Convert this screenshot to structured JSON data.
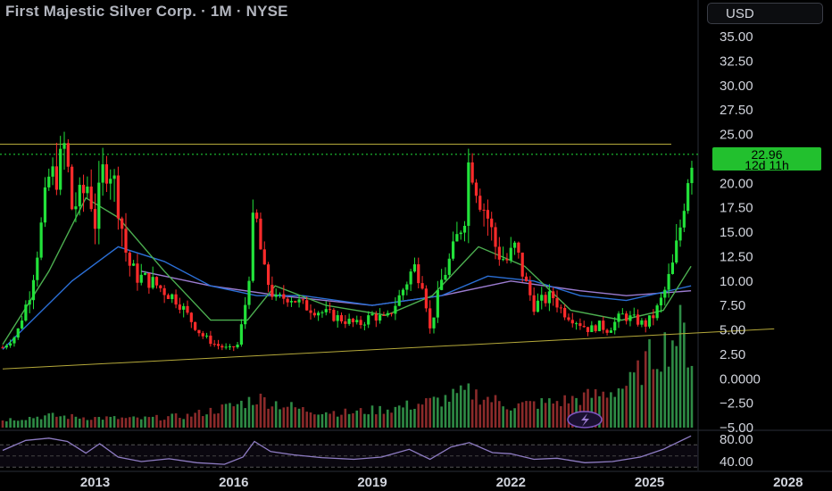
{
  "header": {
    "title": "First Majestic Silver Corp. · 1M · NYSE",
    "currency_button": "USD"
  },
  "last_price": {
    "value": "22.96",
    "countdown": "12d 11h"
  },
  "colors": {
    "up": "#22e23a",
    "down": "#ff2b2b",
    "rsi": "#8e7cc3",
    "trendline": "#b5a93a",
    "ma_fast": "#4caf50",
    "ma_slow": "#2b6fd6",
    "ma_purple": "#9c7cd1",
    "volume_up": "#2e8b45",
    "volume_down": "#8b2a2a",
    "last_price_tag": "#22c02e"
  },
  "icons": {
    "lightning": "lightning-icon"
  },
  "chart_data": {
    "type": "candlestick",
    "symbol": "First Majestic Silver Corp.",
    "interval": "1M",
    "exchange": "NYSE",
    "currency": "USD",
    "price_axis": {
      "ticks": [
        "35.00",
        "32.50",
        "30.00",
        "27.50",
        "25.00",
        "20.00",
        "17.50",
        "15.00",
        "12.50",
        "10.00",
        "7.50",
        "5.00",
        "2.50",
        "0.0000",
        "−2.50",
        "−5.00"
      ],
      "range": [
        -5.2,
        37.5
      ]
    },
    "rsi_axis": {
      "ticks": [
        "80.00",
        "40.00"
      ],
      "range": [
        20,
        92
      ]
    },
    "time_axis": {
      "ticks": [
        "2013",
        "2016",
        "2019",
        "2022",
        "2025",
        "2028"
      ],
      "range": [
        2011.0,
        2028.7
      ]
    },
    "current_price": 22.96,
    "resistance_level": 24.0,
    "support_trendline": [
      {
        "year": 2011.0,
        "price": 1.0
      },
      {
        "year": 2027.7,
        "price": 5.1
      }
    ],
    "close_series": [
      {
        "year": 2011.0,
        "close": 3.2
      },
      {
        "year": 2011.3,
        "close": 4.5
      },
      {
        "year": 2011.6,
        "close": 9.0
      },
      {
        "year": 2011.8,
        "close": 14.5
      },
      {
        "year": 2012.0,
        "close": 20.5
      },
      {
        "year": 2012.2,
        "close": 21.0
      },
      {
        "year": 2012.35,
        "close": 24.0
      },
      {
        "year": 2012.5,
        "close": 17.5
      },
      {
        "year": 2012.7,
        "close": 18.5
      },
      {
        "year": 2012.85,
        "close": 20.0
      },
      {
        "year": 2013.0,
        "close": 16.0
      },
      {
        "year": 2013.2,
        "close": 22.0
      },
      {
        "year": 2013.35,
        "close": 21.5
      },
      {
        "year": 2013.5,
        "close": 18.0
      },
      {
        "year": 2013.7,
        "close": 12.0
      },
      {
        "year": 2013.9,
        "close": 10.5
      },
      {
        "year": 2014.2,
        "close": 10.0
      },
      {
        "year": 2014.5,
        "close": 9.0
      },
      {
        "year": 2014.8,
        "close": 8.0
      },
      {
        "year": 2015.0,
        "close": 6.5
      },
      {
        "year": 2015.3,
        "close": 4.5
      },
      {
        "year": 2015.6,
        "close": 3.5
      },
      {
        "year": 2015.9,
        "close": 3.0
      },
      {
        "year": 2016.1,
        "close": 3.5
      },
      {
        "year": 2016.3,
        "close": 9.0
      },
      {
        "year": 2016.45,
        "close": 17.5
      },
      {
        "year": 2016.65,
        "close": 11.0
      },
      {
        "year": 2016.9,
        "close": 8.0
      },
      {
        "year": 2017.2,
        "close": 8.5
      },
      {
        "year": 2017.5,
        "close": 7.5
      },
      {
        "year": 2017.8,
        "close": 7.0
      },
      {
        "year": 2018.1,
        "close": 6.5
      },
      {
        "year": 2018.4,
        "close": 6.0
      },
      {
        "year": 2018.7,
        "close": 5.5
      },
      {
        "year": 2019.0,
        "close": 6.5
      },
      {
        "year": 2019.3,
        "close": 6.0
      },
      {
        "year": 2019.6,
        "close": 8.5
      },
      {
        "year": 2019.9,
        "close": 11.5
      },
      {
        "year": 2020.1,
        "close": 10.0
      },
      {
        "year": 2020.25,
        "close": 5.0
      },
      {
        "year": 2020.5,
        "close": 10.0
      },
      {
        "year": 2020.75,
        "close": 13.0
      },
      {
        "year": 2021.0,
        "close": 17.0
      },
      {
        "year": 2021.1,
        "close": 23.0
      },
      {
        "year": 2021.3,
        "close": 19.0
      },
      {
        "year": 2021.5,
        "close": 16.5
      },
      {
        "year": 2021.7,
        "close": 13.0
      },
      {
        "year": 2021.9,
        "close": 12.0
      },
      {
        "year": 2022.1,
        "close": 13.5
      },
      {
        "year": 2022.3,
        "close": 10.0
      },
      {
        "year": 2022.5,
        "close": 7.5
      },
      {
        "year": 2022.7,
        "close": 8.0
      },
      {
        "year": 2022.9,
        "close": 8.5
      },
      {
        "year": 2023.1,
        "close": 7.0
      },
      {
        "year": 2023.4,
        "close": 6.0
      },
      {
        "year": 2023.7,
        "close": 5.0
      },
      {
        "year": 2023.9,
        "close": 5.5
      },
      {
        "year": 2024.1,
        "close": 5.0
      },
      {
        "year": 2024.4,
        "close": 6.5
      },
      {
        "year": 2024.7,
        "close": 6.0
      },
      {
        "year": 2024.9,
        "close": 5.5
      },
      {
        "year": 2025.1,
        "close": 6.5
      },
      {
        "year": 2025.3,
        "close": 8.5
      },
      {
        "year": 2025.5,
        "close": 11.5
      },
      {
        "year": 2025.65,
        "close": 15.0
      },
      {
        "year": 2025.8,
        "close": 20.0
      },
      {
        "year": 2025.9,
        "close": 22.96
      }
    ],
    "ma_fast": [
      {
        "year": 2011.0,
        "value": 3.5
      },
      {
        "year": 2012.0,
        "value": 11.0
      },
      {
        "year": 2012.8,
        "value": 18.5
      },
      {
        "year": 2013.5,
        "value": 16.5
      },
      {
        "year": 2014.5,
        "value": 11.0
      },
      {
        "year": 2015.5,
        "value": 6.0
      },
      {
        "year": 2016.3,
        "value": 6.0
      },
      {
        "year": 2016.9,
        "value": 9.5
      },
      {
        "year": 2018.0,
        "value": 7.5
      },
      {
        "year": 2019.3,
        "value": 6.5
      },
      {
        "year": 2020.3,
        "value": 8.5
      },
      {
        "year": 2021.3,
        "value": 13.5
      },
      {
        "year": 2022.3,
        "value": 11.5
      },
      {
        "year": 2023.3,
        "value": 7.0
      },
      {
        "year": 2024.4,
        "value": 6.0
      },
      {
        "year": 2025.3,
        "value": 7.0
      },
      {
        "year": 2025.9,
        "value": 11.5
      }
    ],
    "ma_slow": [
      {
        "year": 2011.0,
        "value": 3.0
      },
      {
        "year": 2012.5,
        "value": 10.0
      },
      {
        "year": 2013.5,
        "value": 13.5
      },
      {
        "year": 2014.5,
        "value": 12.0
      },
      {
        "year": 2015.5,
        "value": 9.5
      },
      {
        "year": 2016.5,
        "value": 8.5
      },
      {
        "year": 2017.5,
        "value": 8.5
      },
      {
        "year": 2019.0,
        "value": 7.5
      },
      {
        "year": 2020.5,
        "value": 8.5
      },
      {
        "year": 2021.5,
        "value": 10.5
      },
      {
        "year": 2022.5,
        "value": 10.0
      },
      {
        "year": 2023.5,
        "value": 8.5
      },
      {
        "year": 2024.5,
        "value": 8.0
      },
      {
        "year": 2025.9,
        "value": 9.5
      }
    ],
    "ma_purple": [
      {
        "year": 2014.0,
        "value": 11.0
      },
      {
        "year": 2015.5,
        "value": 9.5
      },
      {
        "year": 2017.0,
        "value": 8.5
      },
      {
        "year": 2019.0,
        "value": 7.5
      },
      {
        "year": 2020.5,
        "value": 8.5
      },
      {
        "year": 2022.0,
        "value": 10.0
      },
      {
        "year": 2023.5,
        "value": 9.0
      },
      {
        "year": 2024.5,
        "value": 8.5
      },
      {
        "year": 2025.9,
        "value": 9.0
      }
    ],
    "rsi_series": [
      {
        "year": 2011.0,
        "rsi": 60
      },
      {
        "year": 2011.5,
        "rsi": 78
      },
      {
        "year": 2012.0,
        "rsi": 82
      },
      {
        "year": 2012.4,
        "rsi": 76
      },
      {
        "year": 2012.8,
        "rsi": 55
      },
      {
        "year": 2013.1,
        "rsi": 72
      },
      {
        "year": 2013.5,
        "rsi": 48
      },
      {
        "year": 2014.0,
        "rsi": 40
      },
      {
        "year": 2014.6,
        "rsi": 45
      },
      {
        "year": 2015.2,
        "rsi": 38
      },
      {
        "year": 2015.8,
        "rsi": 35
      },
      {
        "year": 2016.2,
        "rsi": 48
      },
      {
        "year": 2016.45,
        "rsi": 76
      },
      {
        "year": 2016.8,
        "rsi": 58
      },
      {
        "year": 2017.3,
        "rsi": 52
      },
      {
        "year": 2017.9,
        "rsi": 47
      },
      {
        "year": 2018.6,
        "rsi": 44
      },
      {
        "year": 2019.2,
        "rsi": 48
      },
      {
        "year": 2019.8,
        "rsi": 62
      },
      {
        "year": 2020.25,
        "rsi": 44
      },
      {
        "year": 2020.7,
        "rsi": 66
      },
      {
        "year": 2021.1,
        "rsi": 74
      },
      {
        "year": 2021.6,
        "rsi": 56
      },
      {
        "year": 2022.0,
        "rsi": 54
      },
      {
        "year": 2022.5,
        "rsi": 44
      },
      {
        "year": 2023.0,
        "rsi": 46
      },
      {
        "year": 2023.6,
        "rsi": 38
      },
      {
        "year": 2024.2,
        "rsi": 40
      },
      {
        "year": 2024.8,
        "rsi": 48
      },
      {
        "year": 2025.3,
        "rsi": 62
      },
      {
        "year": 2025.9,
        "rsi": 86
      }
    ],
    "volume_series": [
      {
        "year": 2011.0,
        "volume": 0.08
      },
      {
        "year": 2012.0,
        "volume": 0.12
      },
      {
        "year": 2013.0,
        "volume": 0.1
      },
      {
        "year": 2014.0,
        "volume": 0.09
      },
      {
        "year": 2015.0,
        "volume": 0.12
      },
      {
        "year": 2016.0,
        "volume": 0.22
      },
      {
        "year": 2016.5,
        "volume": 0.3
      },
      {
        "year": 2017.5,
        "volume": 0.18
      },
      {
        "year": 2018.5,
        "volume": 0.15
      },
      {
        "year": 2019.5,
        "volume": 0.2
      },
      {
        "year": 2020.5,
        "volume": 0.28
      },
      {
        "year": 2021.1,
        "volume": 0.36
      },
      {
        "year": 2022.0,
        "volume": 0.22
      },
      {
        "year": 2023.0,
        "volume": 0.26
      },
      {
        "year": 2024.0,
        "volume": 0.34
      },
      {
        "year": 2024.6,
        "volume": 0.45
      },
      {
        "year": 2025.0,
        "volume": 0.7
      },
      {
        "year": 2025.4,
        "volume": 0.85
      },
      {
        "year": 2025.7,
        "volume": 1.0
      },
      {
        "year": 2025.9,
        "volume": 0.7
      }
    ]
  }
}
